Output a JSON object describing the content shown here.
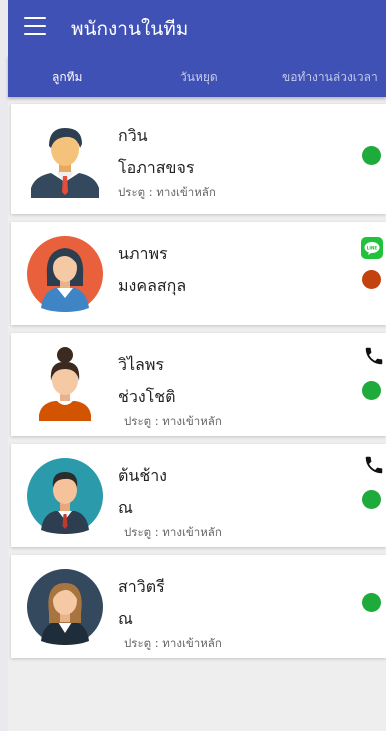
{
  "header": {
    "title": "พนักงานในทีม",
    "menu_icon": "hamburger-menu-icon"
  },
  "tabs": [
    {
      "label": "ลูกทีม",
      "active": true
    },
    {
      "label": "วันหยุด",
      "active": false
    },
    {
      "label": "ขอทำงานล่วงเวลา",
      "active": false
    }
  ],
  "colors": {
    "primary": "#3f51b5",
    "status_online": "#1faa3c",
    "status_offline": "#c3420d",
    "line_green": "#1fc23a"
  },
  "members": [
    {
      "first_name": "กวิน",
      "last_name": "โอภาสขจร",
      "door": "ประตู : ทางเข้าหลัก",
      "status": "online",
      "contact_icon": ""
    },
    {
      "first_name": "นภาพร",
      "last_name": "มงคลสกุล",
      "door": "",
      "status": "offline",
      "contact_icon": "line-icon"
    },
    {
      "first_name": "วิไลพร",
      "last_name": "ช่วงโชติ",
      "door": "ประตู : ทางเข้าหลัก",
      "status": "online",
      "contact_icon": "phone-icon"
    },
    {
      "first_name": "ต้นช้าง",
      "last_name": "ณ",
      "door": "ประตู : ทางเข้าหลัก",
      "status": "online",
      "contact_icon": "phone-icon"
    },
    {
      "first_name": "สาวิตรี",
      "last_name": "ณ",
      "door": "ประตู : ทางเข้าหลัก",
      "status": "online",
      "contact_icon": ""
    }
  ]
}
